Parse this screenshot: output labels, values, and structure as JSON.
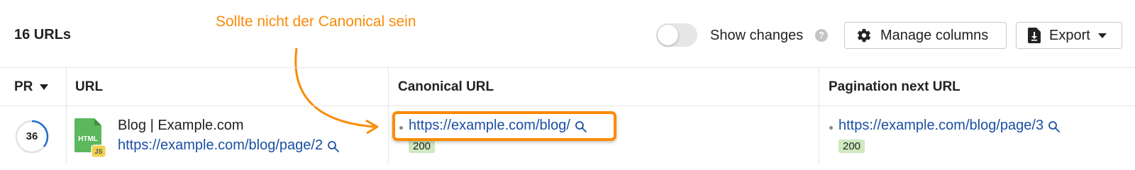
{
  "toolbar": {
    "count_label": "16 URLs",
    "show_changes_label": "Show changes",
    "show_changes_enabled": false,
    "help_glyph": "?",
    "manage_columns_label": "Manage columns",
    "export_label": "Export"
  },
  "annotation": {
    "text": "Sollte nicht der Canonical sein",
    "color": "#fb8a07"
  },
  "table": {
    "columns": {
      "pr": "PR",
      "url": "URL",
      "canonical": "Canonical URL",
      "pagination_next": "Pagination next URL"
    },
    "rows": [
      {
        "pr": "36",
        "pr_fraction": 0.36,
        "file_type": "HTML",
        "file_badge": "JS",
        "title": "Blog | Example.com",
        "url": "https://example.com/blog/page/2",
        "canonical_url": "https://example.com/blog/",
        "canonical_status": "200",
        "pagination_next_url": "https://example.com/blog/page/3",
        "pagination_next_status": "200"
      }
    ]
  },
  "colors": {
    "link": "#1a4fa3",
    "accent": "#fb8a07",
    "pr_ring": "#1f6fd1",
    "status_ok_bg": "#cfe8c0",
    "file_icon": "#5cb85c",
    "js_badge": "#f2d04f"
  },
  "icons": {
    "manage_columns": "gear-icon",
    "export": "download-icon",
    "search": "magnifier-icon",
    "help": "question-icon"
  }
}
